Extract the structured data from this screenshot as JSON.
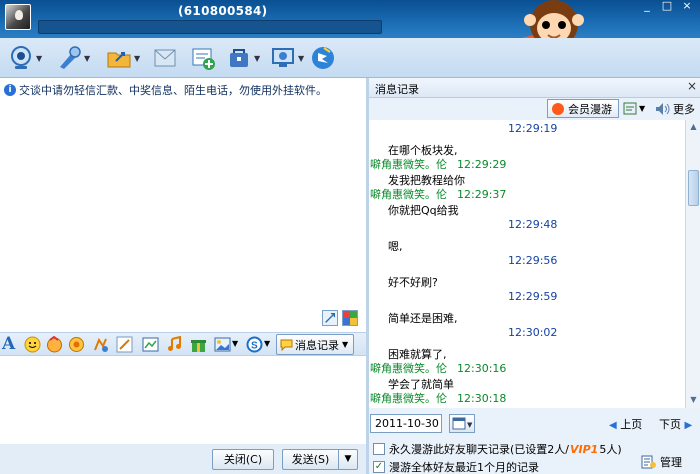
{
  "window": {
    "user_id": "(610800584)",
    "controls": [
      "_",
      "□",
      "×"
    ]
  },
  "toolbar": {
    "tools": [
      {
        "name": "video-call-icon"
      },
      {
        "name": "voice-call-icon"
      },
      {
        "name": "send-file-icon"
      },
      {
        "name": "send-mail-icon"
      },
      {
        "name": "create-discussion-icon"
      },
      {
        "name": "app-center-icon"
      },
      {
        "name": "remote-assist-icon"
      },
      {
        "name": "qzone-icon"
      }
    ]
  },
  "chat": {
    "notice": "交谈中请勿轻信汇款、中奖信息、陌生电话，勿使用外挂软件。"
  },
  "format_bar": {
    "font_glyph": "A",
    "history_label": "消息记录"
  },
  "bottom": {
    "close_label": "关闭(C)",
    "send_label": "发送(S)"
  },
  "history": {
    "title": "消息记录",
    "vip_label": "会员漫游",
    "more_label": "更多",
    "messages": [
      {
        "kind": "time",
        "text": "12:29:19"
      },
      {
        "kind": "body",
        "text": "在哪个板块发,"
      },
      {
        "kind": "sender",
        "name": "噼角惠微笑。伦",
        "time": "12:29:29"
      },
      {
        "kind": "body",
        "text": "发我把教程给你"
      },
      {
        "kind": "sender",
        "name": "噼角惠微笑。伦",
        "time": "12:29:37"
      },
      {
        "kind": "body",
        "text": "你就把Qq给我"
      },
      {
        "kind": "time",
        "text": "12:29:48"
      },
      {
        "kind": "body",
        "text": "嗯,"
      },
      {
        "kind": "time",
        "text": "12:29:56"
      },
      {
        "kind": "body",
        "text": "好不好刷?"
      },
      {
        "kind": "time",
        "text": "12:29:59"
      },
      {
        "kind": "body",
        "text": "简单还是困难,"
      },
      {
        "kind": "time",
        "text": "12:30:02"
      },
      {
        "kind": "body",
        "text": "困难就算了,"
      },
      {
        "kind": "sender",
        "name": "噼角惠微笑。伦",
        "time": "12:30:16"
      },
      {
        "kind": "body",
        "text": "学会了就简单"
      },
      {
        "kind": "sender",
        "name": "噼角惠微笑。伦",
        "time": "12:30:18"
      }
    ],
    "date": "2011-10-30",
    "prev_label": "上页",
    "next_label": "下页",
    "opt1_pre": "永久漫游此好友聊天记录(已设置2人/",
    "opt1_badge": "VIP1",
    "opt1_post": "5人)",
    "opt2": "漫游全体好友最近1个月的记录",
    "manage_label": "管理"
  }
}
